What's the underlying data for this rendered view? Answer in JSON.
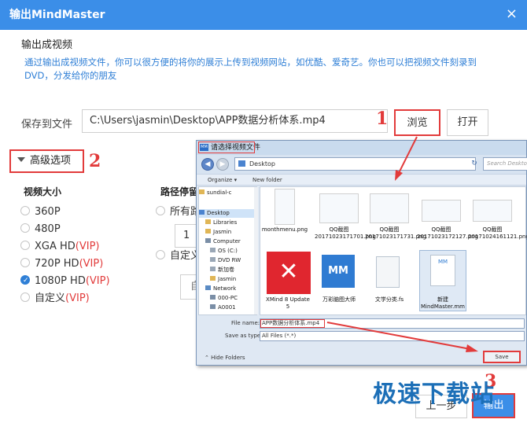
{
  "window": {
    "title": "输出MindMaster",
    "close_label": "×"
  },
  "section": {
    "title": "输出成视频",
    "description": "通过输出成视频文件，你可以很方便的将你的展示上传到视频网站，如优酷、爱奇艺。你也可以把视频文件刻录到DVD，分发给你的朋友"
  },
  "save": {
    "label": "保存到文件",
    "path": "C:\\Users\\jasmin\\Desktop\\APP数据分析体系.mp4",
    "browse_label": "浏览",
    "open_label": "打开"
  },
  "annotations": {
    "step1": "1",
    "step2": "2",
    "step3": "3",
    "color": "#e23b3b"
  },
  "advanced": {
    "label": "高级选项"
  },
  "video_size": {
    "heading": "视频大小",
    "options": [
      {
        "label": "360P",
        "vip": "",
        "selected": false
      },
      {
        "label": "480P",
        "vip": "",
        "selected": false
      },
      {
        "label": "XGA HD",
        "vip": "(VIP)",
        "selected": false
      },
      {
        "label": "720P HD",
        "vip": "(VIP)",
        "selected": false
      },
      {
        "label": "1080P HD",
        "vip": "(VIP)",
        "selected": true
      },
      {
        "label": "自定义",
        "vip": "(VIP)",
        "selected": false
      }
    ]
  },
  "path_pause": {
    "heading": "路径停留时",
    "option1": "所有路",
    "input_value": "1",
    "option2": "自定义",
    "button_partial": "自"
  },
  "footer": {
    "prev_label": "上一步",
    "export_label": "输出"
  },
  "watermark": "极速下载站",
  "file_dialog": {
    "title": "请选择视频文件",
    "title_icon": "MM",
    "address": "Desktop",
    "search_placeholder": "Search Desktop",
    "organize": "Organize ▾",
    "new_folder": "New folder",
    "tree": [
      {
        "label": "sundial-c",
        "selected": false
      },
      {
        "label": "Desktop",
        "selected": true
      },
      {
        "label": "Libraries",
        "selected": false
      },
      {
        "label": "Jasmin",
        "selected": false
      },
      {
        "label": "Computer",
        "selected": false
      },
      {
        "label": "OS (C:)",
        "selected": false
      },
      {
        "label": "DVD RW",
        "selected": false
      },
      {
        "label": "新加卷",
        "selected": false
      },
      {
        "label": "Jasmin",
        "selected": false
      },
      {
        "label": "Network",
        "selected": false
      },
      {
        "label": "000-PC",
        "selected": false
      },
      {
        "label": "A0001",
        "selected": false
      },
      {
        "label": "A0002",
        "selected": false
      }
    ],
    "files_row1": [
      "monthmenu.png",
      "QQ截图20171023171701.png",
      "QQ截图20171023171731.png",
      "QQ截图20171023172127.png",
      "QQ截图20171024161121.png"
    ],
    "files_row2": [
      "XMind 8 Update 5",
      "万彩脑图大师",
      "文学分类.fs",
      "新建MindMaster.mm"
    ],
    "file_name_label": "File name:",
    "file_name_value": "APP数据分析体系.mp4",
    "save_type_label": "Save as type:",
    "save_type_value": "All Files (*.*)",
    "hide_folders": "Hide Folders",
    "save_button": "Save"
  }
}
